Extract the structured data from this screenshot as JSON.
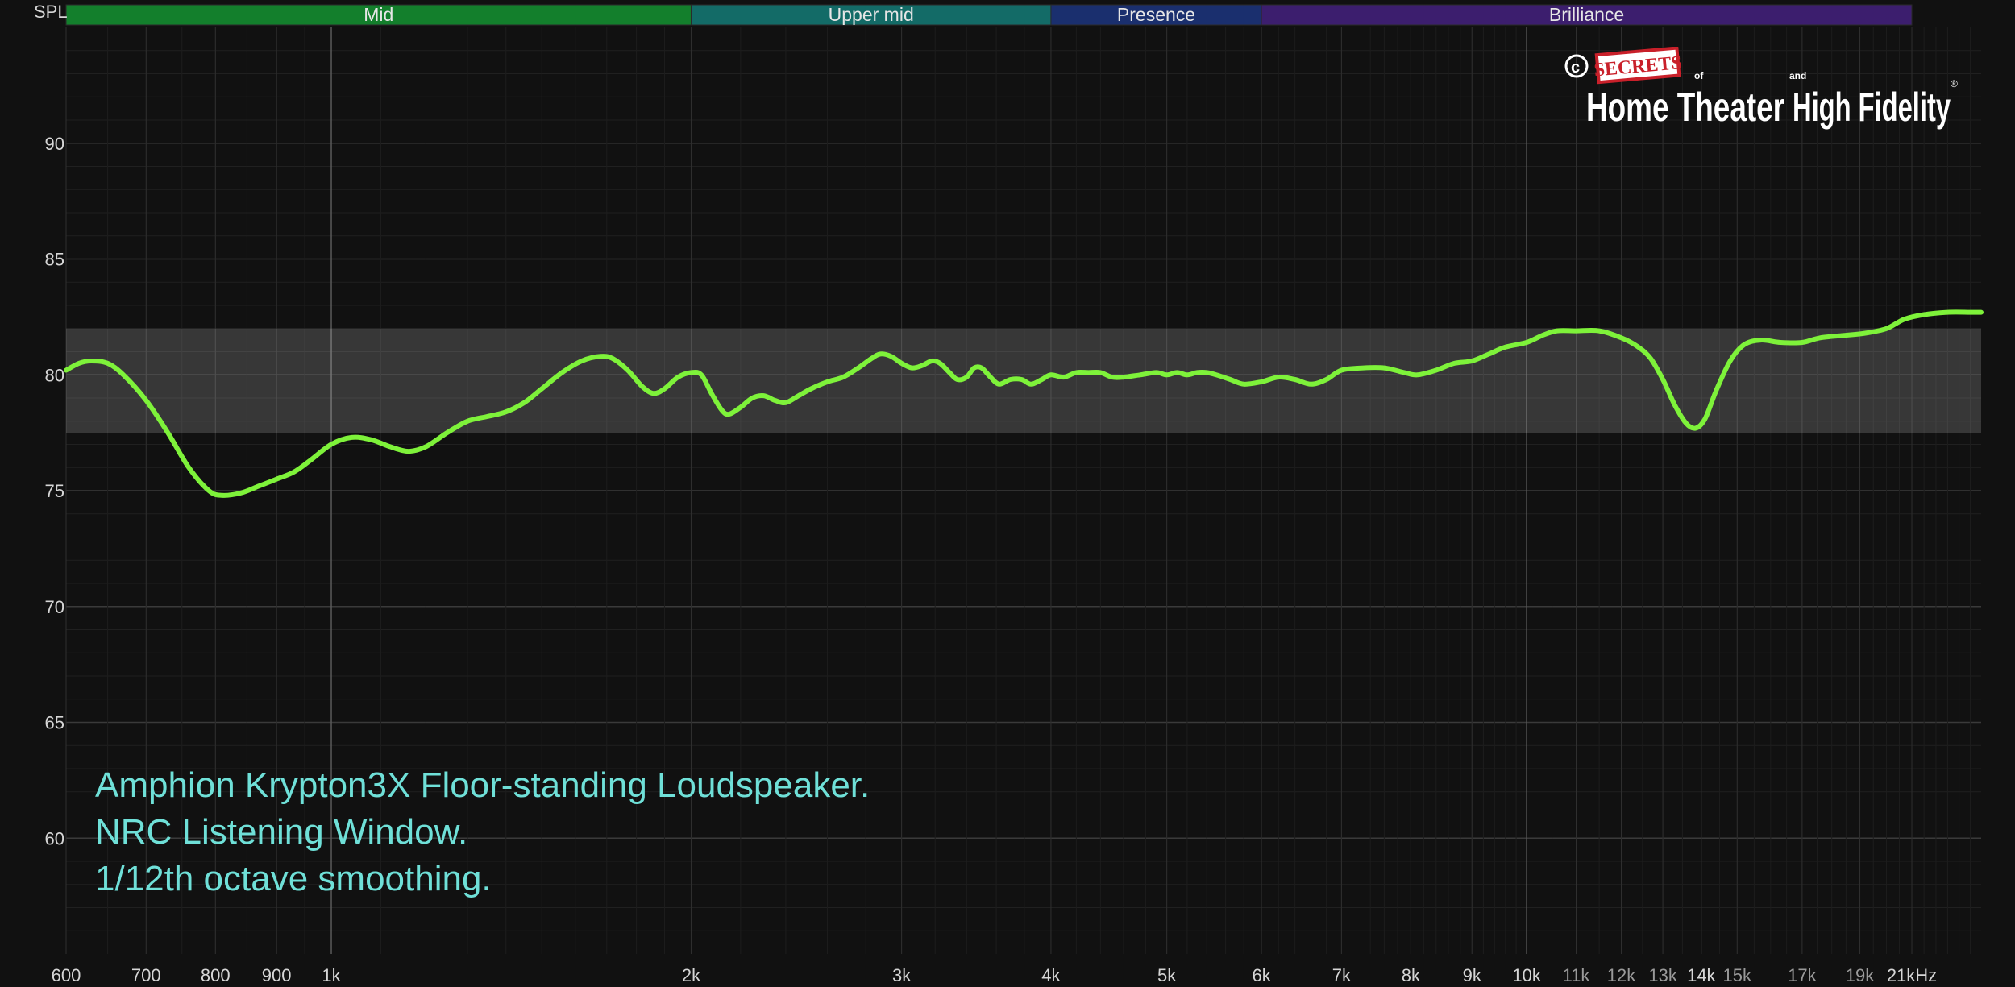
{
  "chart_data": {
    "type": "line",
    "y_axis_label": "SPL",
    "x_unit_label": "21kHz",
    "x_scale": "log",
    "xlim": [
      600,
      24000
    ],
    "ylim": [
      55,
      95
    ],
    "grid": true,
    "y_ticks": [
      {
        "value": 60,
        "label": "60"
      },
      {
        "value": 65,
        "label": "65"
      },
      {
        "value": 70,
        "label": "70"
      },
      {
        "value": 75,
        "label": "75"
      },
      {
        "value": 80,
        "label": "80"
      },
      {
        "value": 85,
        "label": "85"
      },
      {
        "value": 90,
        "label": "90"
      }
    ],
    "x_ticks": [
      {
        "value": 600,
        "label": "600",
        "major": true
      },
      {
        "value": 700,
        "label": "700",
        "major": true
      },
      {
        "value": 800,
        "label": "800",
        "major": true
      },
      {
        "value": 900,
        "label": "900",
        "major": true
      },
      {
        "value": 1000,
        "label": "1k",
        "major": true
      },
      {
        "value": 2000,
        "label": "2k",
        "major": true
      },
      {
        "value": 3000,
        "label": "3k",
        "major": true
      },
      {
        "value": 4000,
        "label": "4k",
        "major": true
      },
      {
        "value": 5000,
        "label": "5k",
        "major": true
      },
      {
        "value": 6000,
        "label": "6k",
        "major": true
      },
      {
        "value": 7000,
        "label": "7k",
        "major": true
      },
      {
        "value": 8000,
        "label": "8k",
        "major": true
      },
      {
        "value": 9000,
        "label": "9k",
        "major": true
      },
      {
        "value": 10000,
        "label": "10k",
        "major": true
      },
      {
        "value": 11000,
        "label": "11k",
        "major": false
      },
      {
        "value": 12000,
        "label": "12k",
        "major": false
      },
      {
        "value": 13000,
        "label": "13k",
        "major": false
      },
      {
        "value": 14000,
        "label": "14k",
        "major": true
      },
      {
        "value": 15000,
        "label": "15k",
        "major": false
      },
      {
        "value": 17000,
        "label": "17k",
        "major": false
      },
      {
        "value": 19000,
        "label": "19k",
        "major": false
      },
      {
        "value": 21000,
        "label": "21kHz",
        "major": true
      }
    ],
    "bands": [
      {
        "name": "Mid",
        "from": 600,
        "to": 2000,
        "color": "#137f2c"
      },
      {
        "name": "Upper mid",
        "from": 2000,
        "to": 4000,
        "color": "#136b67"
      },
      {
        "name": "Presence",
        "from": 4000,
        "to": 6000,
        "color": "#1a2f6e"
      },
      {
        "name": "Brilliance",
        "from": 6000,
        "to": 21000,
        "color": "#3c1e6e"
      }
    ],
    "tolerance_band": [
      77.5,
      82
    ],
    "series": [
      {
        "color": "#7ef23a",
        "points": [
          [
            600,
            80.2
          ],
          [
            615,
            80.5
          ],
          [
            630,
            80.6
          ],
          [
            650,
            80.5
          ],
          [
            670,
            80.0
          ],
          [
            700,
            78.9
          ],
          [
            730,
            77.5
          ],
          [
            760,
            76.0
          ],
          [
            790,
            75.0
          ],
          [
            810,
            74.8
          ],
          [
            840,
            74.9
          ],
          [
            870,
            75.2
          ],
          [
            900,
            75.5
          ],
          [
            930,
            75.8
          ],
          [
            960,
            76.3
          ],
          [
            1000,
            77.0
          ],
          [
            1040,
            77.3
          ],
          [
            1080,
            77.2
          ],
          [
            1120,
            76.9
          ],
          [
            1160,
            76.7
          ],
          [
            1200,
            76.9
          ],
          [
            1250,
            77.5
          ],
          [
            1300,
            78.0
          ],
          [
            1350,
            78.2
          ],
          [
            1400,
            78.4
          ],
          [
            1450,
            78.8
          ],
          [
            1500,
            79.4
          ],
          [
            1560,
            80.1
          ],
          [
            1620,
            80.6
          ],
          [
            1680,
            80.8
          ],
          [
            1720,
            80.7
          ],
          [
            1770,
            80.2
          ],
          [
            1820,
            79.5
          ],
          [
            1860,
            79.2
          ],
          [
            1900,
            79.4
          ],
          [
            1950,
            79.9
          ],
          [
            2000,
            80.1
          ],
          [
            2040,
            80.0
          ],
          [
            2080,
            79.2
          ],
          [
            2120,
            78.5
          ],
          [
            2150,
            78.3
          ],
          [
            2200,
            78.6
          ],
          [
            2250,
            79.0
          ],
          [
            2300,
            79.1
          ],
          [
            2350,
            78.9
          ],
          [
            2400,
            78.8
          ],
          [
            2460,
            79.1
          ],
          [
            2520,
            79.4
          ],
          [
            2600,
            79.7
          ],
          [
            2680,
            79.9
          ],
          [
            2760,
            80.3
          ],
          [
            2830,
            80.7
          ],
          [
            2880,
            80.9
          ],
          [
            2940,
            80.8
          ],
          [
            3000,
            80.5
          ],
          [
            3060,
            80.3
          ],
          [
            3120,
            80.4
          ],
          [
            3180,
            80.6
          ],
          [
            3230,
            80.5
          ],
          [
            3290,
            80.1
          ],
          [
            3340,
            79.8
          ],
          [
            3400,
            79.9
          ],
          [
            3450,
            80.3
          ],
          [
            3500,
            80.3
          ],
          [
            3560,
            79.9
          ],
          [
            3620,
            79.6
          ],
          [
            3700,
            79.8
          ],
          [
            3780,
            79.8
          ],
          [
            3850,
            79.6
          ],
          [
            3930,
            79.8
          ],
          [
            4000,
            80.0
          ],
          [
            4100,
            79.9
          ],
          [
            4200,
            80.1
          ],
          [
            4300,
            80.1
          ],
          [
            4400,
            80.1
          ],
          [
            4500,
            79.9
          ],
          [
            4600,
            79.9
          ],
          [
            4750,
            80.0
          ],
          [
            4900,
            80.1
          ],
          [
            5000,
            80.0
          ],
          [
            5100,
            80.1
          ],
          [
            5200,
            80.0
          ],
          [
            5300,
            80.1
          ],
          [
            5400,
            80.1
          ],
          [
            5500,
            80.0
          ],
          [
            5650,
            79.8
          ],
          [
            5800,
            79.6
          ],
          [
            6000,
            79.7
          ],
          [
            6200,
            79.9
          ],
          [
            6400,
            79.8
          ],
          [
            6600,
            79.6
          ],
          [
            6800,
            79.8
          ],
          [
            7000,
            80.2
          ],
          [
            7300,
            80.3
          ],
          [
            7600,
            80.3
          ],
          [
            7900,
            80.1
          ],
          [
            8100,
            80.0
          ],
          [
            8400,
            80.2
          ],
          [
            8700,
            80.5
          ],
          [
            9000,
            80.6
          ],
          [
            9300,
            80.9
          ],
          [
            9600,
            81.2
          ],
          [
            10000,
            81.4
          ],
          [
            10300,
            81.7
          ],
          [
            10600,
            81.9
          ],
          [
            11000,
            81.9
          ],
          [
            11500,
            81.9
          ],
          [
            12000,
            81.6
          ],
          [
            12400,
            81.2
          ],
          [
            12700,
            80.7
          ],
          [
            13000,
            79.8
          ],
          [
            13300,
            78.7
          ],
          [
            13600,
            77.9
          ],
          [
            13850,
            77.7
          ],
          [
            14100,
            78.1
          ],
          [
            14400,
            79.3
          ],
          [
            14800,
            80.6
          ],
          [
            15200,
            81.3
          ],
          [
            15700,
            81.5
          ],
          [
            16300,
            81.4
          ],
          [
            17000,
            81.4
          ],
          [
            17600,
            81.6
          ],
          [
            18400,
            81.7
          ],
          [
            19200,
            81.8
          ],
          [
            20000,
            82.0
          ],
          [
            20700,
            82.4
          ],
          [
            21500,
            82.6
          ],
          [
            22500,
            82.7
          ],
          [
            23500,
            82.7
          ],
          [
            24000,
            82.7
          ]
        ]
      }
    ],
    "caption_lines": [
      "Amphion Krypton3X Floor-standing Loudspeaker.",
      "NRC Listening Window.",
      "1/12th octave smoothing."
    ],
    "watermark": {
      "copyright": "©",
      "stamp": "SECRETS",
      "small_of": "of",
      "small_and": "and",
      "line1": "Home Theater",
      "line2": "High Fidelity",
      "registered": "®"
    }
  }
}
